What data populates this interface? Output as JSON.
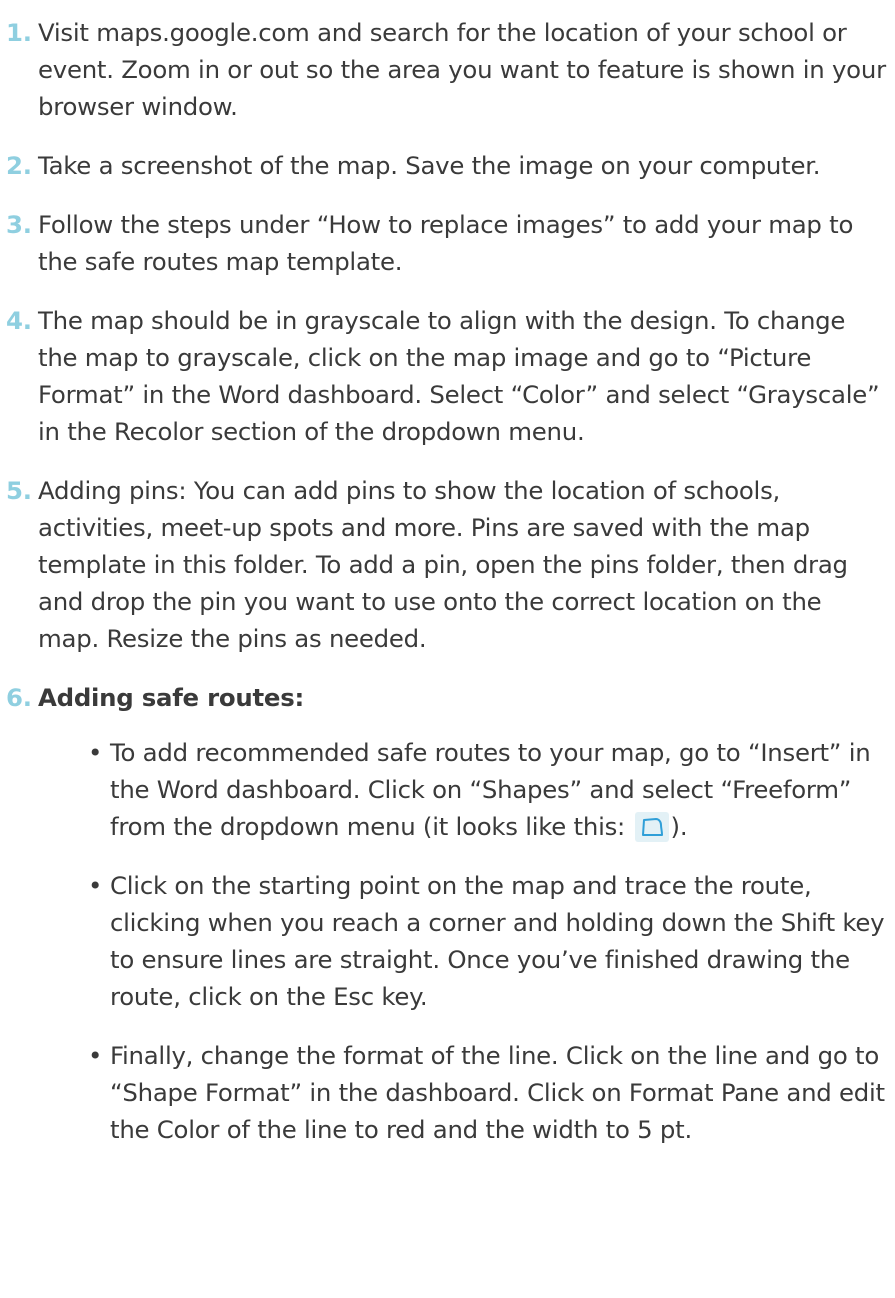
{
  "steps": [
    {
      "number": "1.",
      "text": "Visit maps.google.com and search for the location of your school or event. Zoom in or out so the area you want to feature is shown in your browser window."
    },
    {
      "number": "2.",
      "text": "Take a screenshot of the map. Save the image on your computer."
    },
    {
      "number": "3.",
      "text": "Follow the steps under “How to replace images” to add your map to the safe routes map template."
    },
    {
      "number": "4.",
      "text": "The map should be in grayscale to align with the design. To change the map to grayscale, click on the map image and go to “Picture Format” in the Word dashboard. Select “Color” and select “Grayscale” in the Recolor section of the dropdown menu."
    },
    {
      "number": "5.",
      "text": "Adding pins: You can add pins to show the location of schools, activities, meet-up spots and more. Pins are saved with the map template in this folder. To add a pin, open the pins folder, then drag and drop the pin you want to use onto the correct location on the map. Resize the pins as needed."
    },
    {
      "number": "6.",
      "heading": "Adding safe routes:",
      "bullets": [
        {
          "text_before_icon": "To add recommended safe routes to your map, go to “Insert” in the Word dashboard. Click on “Shapes” and select “Freeform” from the dropdown menu (it looks like this:",
          "icon": "freeform-shape-icon",
          "text_after_icon": ")."
        },
        {
          "text": "Click on the starting point on the map and trace the route, clicking when you reach a corner and holding down the Shift key to ensure lines are straight. Once you’ve finished drawing the route, click on the Esc key."
        },
        {
          "text": "Finally, change the format of the line. Click on the line and go to “Shape Format” in the dashboard. Click on Format Pane and edit the Color of the line to red and the width to 5 pt."
        }
      ]
    }
  ],
  "bullet_symbol": "•",
  "colors": {
    "step_number": "#8fcfe0",
    "body_text": "#3a3a3a",
    "icon_background": "#e3f1f6",
    "icon_stroke": "#2f9fd8"
  }
}
